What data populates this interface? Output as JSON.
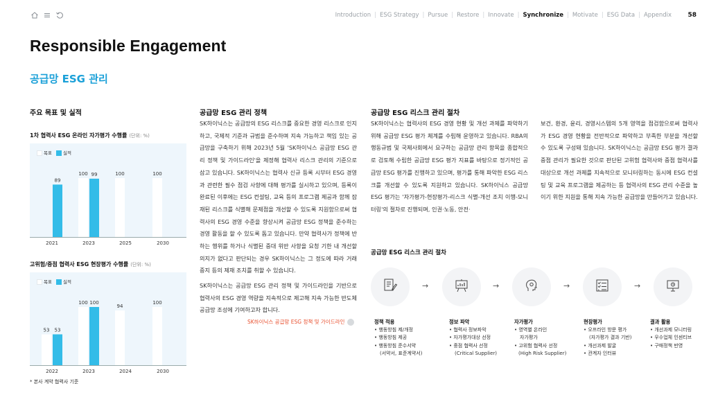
{
  "nav": {
    "links": [
      {
        "label": "Introduction"
      },
      {
        "label": "ESG Strategy"
      },
      {
        "label": "Pursue"
      },
      {
        "label": "Restore"
      },
      {
        "label": "Innovate"
      },
      {
        "label": "Synchronize"
      },
      {
        "label": "Motivate"
      },
      {
        "label": "ESG Data"
      },
      {
        "label": "Appendix"
      }
    ],
    "active": "Synchronize",
    "page": "58"
  },
  "title": "Responsible Engagement",
  "subtitle": "공급망 ESG 관리",
  "goals": {
    "heading": "주요 목표 및 실적",
    "footnote": "* 본사 계약 협력사 기준"
  },
  "chart_data": [
    {
      "type": "bar",
      "title": "1차 협력사 ESG 온라인 자가평가 수행률",
      "unit": "(단위: %)",
      "categories": [
        "2021",
        "2023",
        "2025",
        "2030"
      ],
      "series": [
        {
          "name": "목표",
          "values": [
            null,
            100,
            100,
            100
          ],
          "labels": [
            "",
            "100",
            "100",
            "100"
          ]
        },
        {
          "name": "실적",
          "values": [
            89,
            99,
            null,
            null
          ],
          "labels": [
            "89",
            "99",
            "",
            ""
          ]
        }
      ],
      "ylim": [
        0,
        100
      ],
      "colors": {
        "target": "#ffffff",
        "actual": "#33bce8"
      }
    },
    {
      "type": "bar",
      "title": "고위험/중점 협력사 ESG 현장평가 수행률",
      "unit": "(단위: %)",
      "categories": [
        "2022",
        "2023",
        "2024",
        "2030"
      ],
      "series": [
        {
          "name": "목표",
          "values": [
            53,
            100,
            94,
            100
          ],
          "labels": [
            "53",
            "100",
            "94",
            "100"
          ]
        },
        {
          "name": "실적",
          "values": [
            53,
            100,
            null,
            null
          ],
          "labels": [
            "53",
            "100",
            "",
            ""
          ]
        }
      ],
      "ylim": [
        0,
        100
      ],
      "colors": {
        "target": "#ffffff",
        "actual": "#33bce8"
      }
    }
  ],
  "policy": {
    "heading": "공급망 ESG 관리 정책",
    "para1": "SK하이닉스는 공급망의 ESG 리스크를 중요한 경영 리스크로 인지하고, 국제적 기준과 규범을 준수하며 지속 가능하고 책임 있는 공급망을 구축하기 위해 2023년 5월 'SK하이닉스 공급망 ESG 관리 정책 및 가이드라인'을 제정해 협력사 리스크 관리의 기준으로 삼고 있습니다. SK하이닉스는 협력사 신규 등록 시부터 ESG 경영과 관련한 필수 점검 사항에 대해 평가를 실시하고 있으며, 등록이 완료된 이후에는 ESG 컨설팅, 교육 등의 프로그램 제공과 함께 잠재된 리스크를 식별해 문제점을 개선할 수 있도록 지원함으로써 협력사의 ESG 경영 수준을 향상시켜 공급망 ESG 정책을 준수하는 경영 활동을 할 수 있도록 돕고 있습니다. 만약 협력사가 정책에 반하는 행위를 하거나 식별된 중대 위반 사항을 요청 기한 내 개선할 의지가 없다고 판단되는 경우 SK하이닉스는 그 정도에 따라 거래 중지 등의 제재 조치를 취할 수 있습니다.",
    "para2": "SK하이닉스는 공급망 ESG 관리 정책 및 가이드라인을 기반으로 협력사의 ESG 경영 역량을 지속적으로 제고해 지속 가능한 반도체 공급망 조성에 기여하고자 합니다.",
    "link": "SK하이닉스 공급망 ESG 정책 및 가이드라인"
  },
  "procedure": {
    "heading": "공급망 ESG 리스크 관리 절차",
    "para1": "SK하이닉스는 협력사의 ESG 경영 현황 및 개선 과제를 파악하기 위해 공급망 ESG 평가 체계를 수립해 운영하고 있습니다. RBA의 행동규범 및 국제사회에서 요구하는 공급망 관리 항목을 종합적으로 검토해 수립한 공급망 ESG 평가 지표를 바탕으로 정기적인 공급망 ESG 평가를 진행하고 있으며, 평가를 통해 파악한 ESG 리스크를 개선할 수 있도록 지원하고 있습니다. SK하이닉스 공급망 ESG 평가는 '자가평가-현장평가-리스크 식별-개선 조치 이행-모니터링'의 절차로 진행되며, 인권·노동, 안전·",
    "para2": "보건, 환경, 윤리, 경영시스템의 5개 영역을 점검함으로써 협력사가 ESG 경영 현황을 전반적으로 파악하고 부족한 부분을 개선할 수 있도록 구성돼 있습니다. SK하이닉스는 공급망 ESG 평가 결과 중점 관리가 필요한 것으로 판단된 고위험 협력사와 중점 협력사를 대상으로 개선 과제를 지속적으로 모니터링하는 동시에 ESG 컨설팅 및 교육 프로그램을 제공하는 등 협력사의 ESG 관리 수준을 높이기 위한 지원을 통해 지속 가능한 공급망을 만들어가고 있습니다.",
    "chart_heading": "공급망 ESG 리스크 관리 절차",
    "steps": [
      {
        "title": "정책 적용",
        "items": [
          "• 행동방침 제/개정",
          "• 행동방침 제공",
          "• 행동방침 준수서약",
          "(서약서, 표준계약서)"
        ],
        "icon": "document-pen-icon"
      },
      {
        "title": "정보 파악",
        "items": [
          "• 협력사 정보파악",
          "• 자가평가대상 선정",
          "• 중점 협력사 선정",
          "(Critical Supplier)"
        ],
        "icon": "easel-chart-icon"
      },
      {
        "title": "자가평가",
        "items": [
          "• 영역별 온라인",
          "자가평가",
          "• 고위험 협력사 선정",
          "(High Risk Supplier)"
        ],
        "icon": "head-gear-icon"
      },
      {
        "title": "현장평가",
        "items": [
          "• 오프라인 방문 평가",
          "(자가평가 결과 기반)",
          "• 개선과제 발굴",
          "• 관계자 인터뷰"
        ],
        "icon": "checklist-icon"
      },
      {
        "title": "결과 활용",
        "items": [
          "• 개선과제 모니터링",
          "• 우수업체 인센티브",
          "• 구매정책 반영"
        ],
        "icon": "monitor-icon"
      }
    ]
  }
}
